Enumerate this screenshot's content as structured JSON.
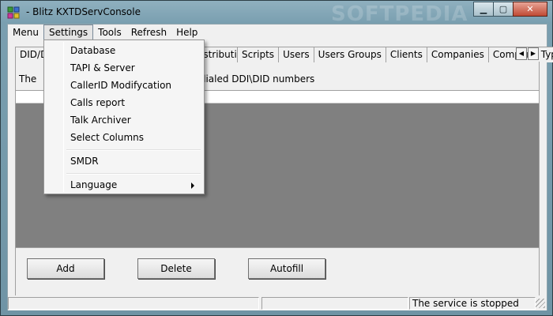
{
  "window": {
    "title": "- Blitz KXTDServConsole",
    "watermark": "SOFTPEDIA",
    "controls": {
      "minimize": "▁",
      "maximize": "▢",
      "close": "✕"
    }
  },
  "menubar": {
    "items": [
      "Menu",
      "Settings",
      "Tools",
      "Refresh",
      "Help"
    ],
    "active": "Settings"
  },
  "settings_menu": {
    "items": [
      "Database",
      "TAPI & Server",
      "CallerID Modifycation",
      "Calls report",
      "Talk Archiver",
      "Select Columns",
      "SMDR",
      "Language"
    ],
    "submenu_indicator_on": "Language"
  },
  "tabs": {
    "items": [
      "DID/D",
      "istribution",
      "Scripts",
      "Users",
      "Users Groups",
      "Clients",
      "Companies",
      "Company Type"
    ],
    "scroll_left": "◀",
    "scroll_right": "▶"
  },
  "panel": {
    "info_text_start": "The",
    "info_text_end": "ect dialed DDI\\DID numbers"
  },
  "buttons": {
    "add": "Add",
    "delete": "Delete",
    "autofill": "Autofill"
  },
  "statusbar": {
    "status_text": "The service is stopped"
  }
}
